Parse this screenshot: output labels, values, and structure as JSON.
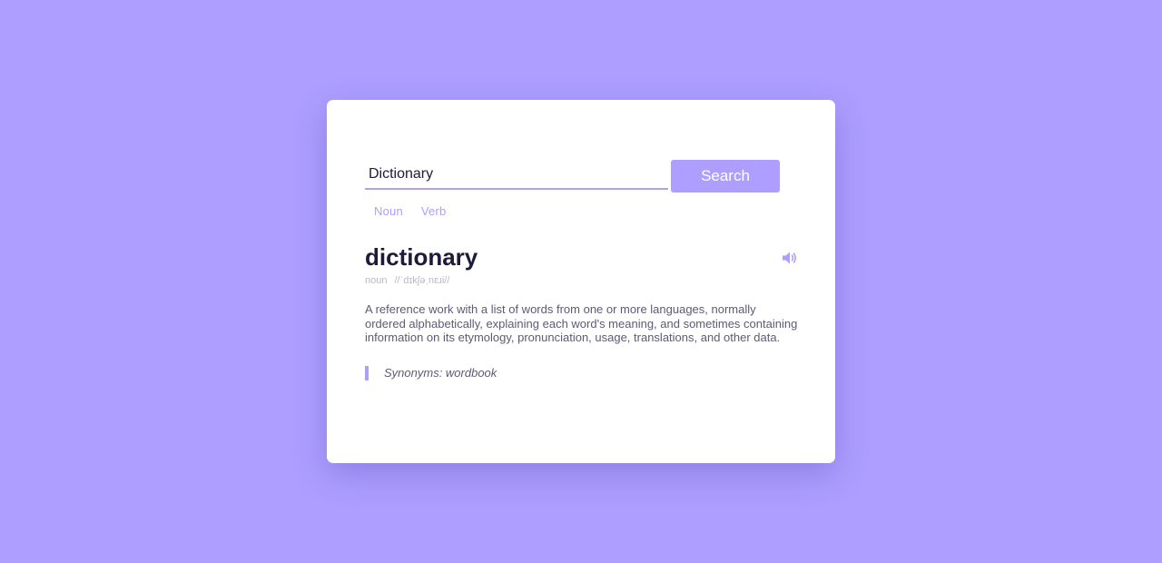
{
  "search": {
    "value": "Dictionary",
    "button_label": "Search"
  },
  "pos_tabs": [
    "Noun",
    "Verb"
  ],
  "entry": {
    "word": "dictionary",
    "part_of_speech": "noun",
    "pronunciation": "//ˈdɪkʃəˌnɛɹi//",
    "definition": "A reference work with a list of words from one or more languages, normally ordered alphabetically, explaining each word's meaning, and sometimes containing information on its etymology, pronunciation, usage, translations, and other data.",
    "synonyms_label": "Synonyms: wordbook"
  },
  "icons": {
    "speaker": "speaker-volume-icon"
  },
  "colors": {
    "background": "#ad9eff",
    "accent": "#ad9eff",
    "card": "#ffffff",
    "heading": "#1d1b3a",
    "body_text": "#5d5b72",
    "muted_text": "#b9b7c9"
  }
}
